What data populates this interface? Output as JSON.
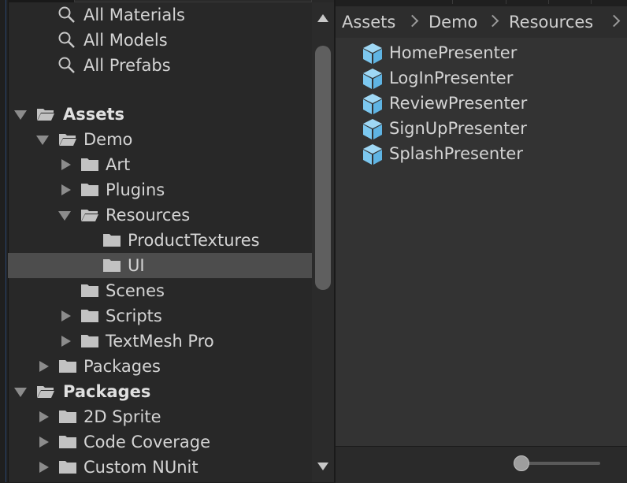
{
  "tree": {
    "favorites": [
      {
        "label": "All Materials"
      },
      {
        "label": "All Models"
      },
      {
        "label": "All Prefabs"
      }
    ],
    "items": [
      {
        "label": "Assets",
        "bold": true
      },
      {
        "label": "Demo"
      },
      {
        "label": "Art"
      },
      {
        "label": "Plugins"
      },
      {
        "label": "Resources"
      },
      {
        "label": "ProductTextures"
      },
      {
        "label": "UI",
        "selected": true
      },
      {
        "label": "Scenes"
      },
      {
        "label": "Scripts"
      },
      {
        "label": "TextMesh Pro"
      },
      {
        "label": "Packages"
      },
      {
        "label": "Packages",
        "bold": true
      },
      {
        "label": "2D Sprite"
      },
      {
        "label": "Code Coverage"
      },
      {
        "label": "Custom NUnit"
      }
    ]
  },
  "breadcrumb": [
    "Assets",
    "Demo",
    "Resources"
  ],
  "assets": [
    {
      "name": "HomePresenter"
    },
    {
      "name": "LogInPresenter"
    },
    {
      "name": "ReviewPresenter"
    },
    {
      "name": "SignUpPresenter"
    },
    {
      "name": "SplashPresenter"
    }
  ],
  "zoom_slider": {
    "value": 0.05
  },
  "colors": {
    "selection": "#4d4d4d",
    "cube_icon": "#7cc8f0",
    "folder_icon": "#c2c2c2"
  }
}
